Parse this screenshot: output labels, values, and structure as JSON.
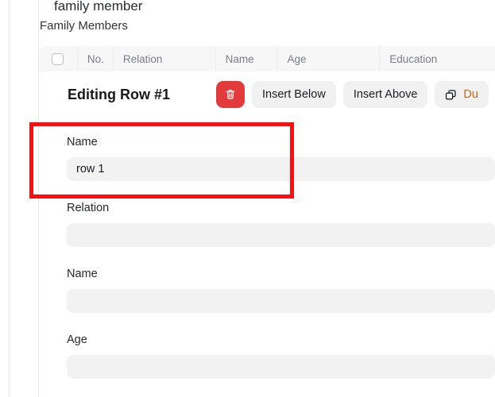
{
  "page": {
    "doc_heading": "family member",
    "section_label": "Family Members"
  },
  "table": {
    "columns": [
      {
        "key": "select",
        "label": ""
      },
      {
        "key": "no",
        "label": "No."
      },
      {
        "key": "relation",
        "label": "Relation"
      },
      {
        "key": "name",
        "label": "Name"
      },
      {
        "key": "age",
        "label": "Age"
      },
      {
        "key": "education",
        "label": "Education"
      }
    ],
    "select_all_checked": false
  },
  "edit_panel": {
    "title": "Editing Row #1",
    "actions": {
      "delete_icon": "trash-icon",
      "insert_below": "Insert Below",
      "insert_above": "Insert Above",
      "duplicate_icon": "copy-icon",
      "duplicate": "Du"
    },
    "fields": [
      {
        "label": "Name",
        "value": "row 1",
        "placeholder": ""
      },
      {
        "label": "Relation",
        "value": "",
        "placeholder": ""
      },
      {
        "label": "Name",
        "value": "",
        "placeholder": ""
      },
      {
        "label": "Age",
        "value": "",
        "placeholder": ""
      }
    ]
  },
  "annotation": {
    "color": "#fb0d10",
    "target": "name-field-row-1"
  },
  "colors": {
    "danger": "#e13b3b",
    "button_bg": "#f1f1f2",
    "input_bg": "#f2f2f3",
    "table_header_bg": "#f7f7f8",
    "duplicate_text": "#c06a15"
  }
}
